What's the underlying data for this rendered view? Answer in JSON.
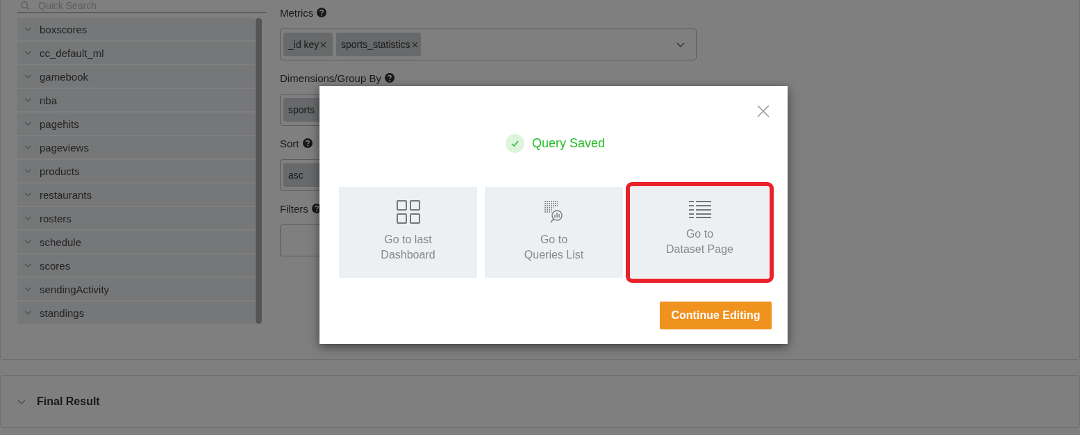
{
  "search": {
    "placeholder": "Quick Search"
  },
  "collections": [
    "boxscores",
    "cc_default_ml",
    "gamebook",
    "nba",
    "pagehits",
    "pageviews",
    "products",
    "restaurants",
    "rosters",
    "schedule",
    "scores",
    "sendingActivity",
    "standings"
  ],
  "fields": [
    {
      "label": "Metrics",
      "dropdown": true,
      "chips": [
        {
          "label": "_id key",
          "removable": true
        },
        {
          "label": "sports_statistics",
          "removable": true
        }
      ]
    },
    {
      "label": "Dimensions/Group By",
      "chips": [
        {
          "label": "sports"
        }
      ]
    },
    {
      "label": "Sort",
      "chips": [
        {
          "label": "asc"
        }
      ]
    },
    {
      "label": "Filters"
    }
  ],
  "final_result": {
    "title": "Final Result"
  },
  "modal": {
    "message": "Query Saved",
    "options": [
      {
        "kind": "dashboard",
        "lines": [
          "Go to last",
          "Dashboard"
        ],
        "highlighted": false
      },
      {
        "kind": "queries",
        "lines": [
          "Go to",
          "Queries List"
        ],
        "highlighted": false
      },
      {
        "kind": "dataset",
        "lines": [
          "Go to",
          "Dataset Page"
        ],
        "highlighted": true
      }
    ],
    "button": "Continue Editing"
  }
}
